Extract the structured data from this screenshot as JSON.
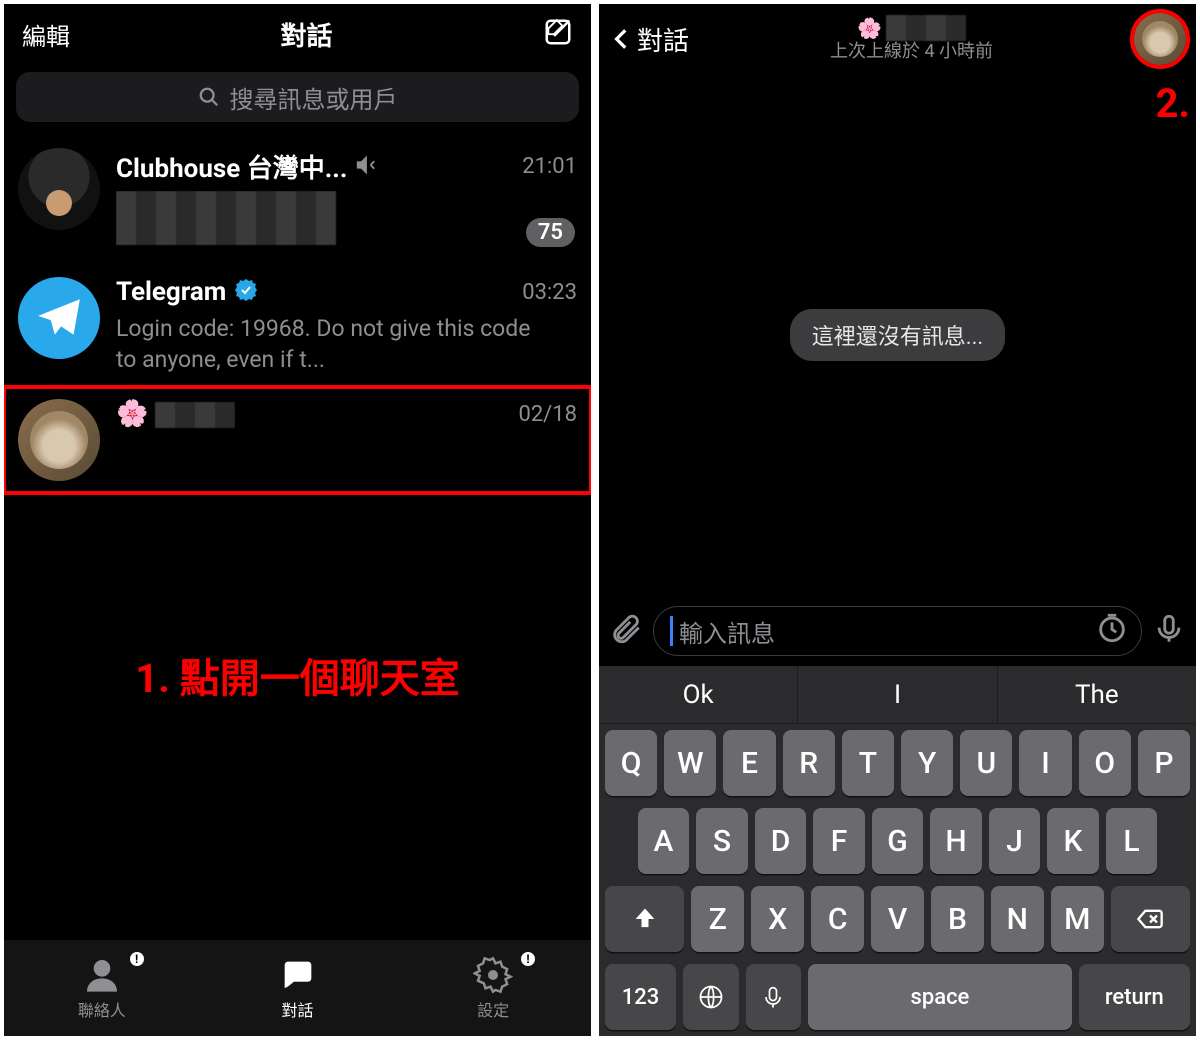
{
  "left": {
    "header": {
      "edit": "編輯",
      "title": "對話"
    },
    "search_placeholder": "搜尋訊息或用戶",
    "chats": [
      {
        "name": "Clubhouse 台灣中...",
        "time": "21:01",
        "muted": true,
        "badge": "75"
      },
      {
        "name": "Telegram",
        "time": "03:23",
        "verified": true,
        "preview": "Login code: 19968. Do not give this code to anyone, even if t..."
      },
      {
        "name_emoji": "🌸",
        "time": "02/18"
      }
    ],
    "annotation": "1. 點開一個聊天室",
    "tabs": {
      "contacts": "聯絡人",
      "chats": "對話",
      "settings": "設定"
    }
  },
  "right": {
    "back": "對話",
    "user_emoji": "🌸",
    "status": "上次上線於 4 小時前",
    "annotation": "2.",
    "empty": "這裡還沒有訊息...",
    "input_placeholder": "輸入訊息",
    "suggestions": [
      "Ok",
      "I",
      "The"
    ],
    "keys_r1": [
      "Q",
      "W",
      "E",
      "R",
      "T",
      "Y",
      "U",
      "I",
      "O",
      "P"
    ],
    "keys_r2": [
      "A",
      "S",
      "D",
      "F",
      "G",
      "H",
      "J",
      "K",
      "L"
    ],
    "keys_r3": [
      "Z",
      "X",
      "C",
      "V",
      "B",
      "N",
      "M"
    ],
    "key_123": "123",
    "key_space": "space",
    "key_return": "return"
  }
}
